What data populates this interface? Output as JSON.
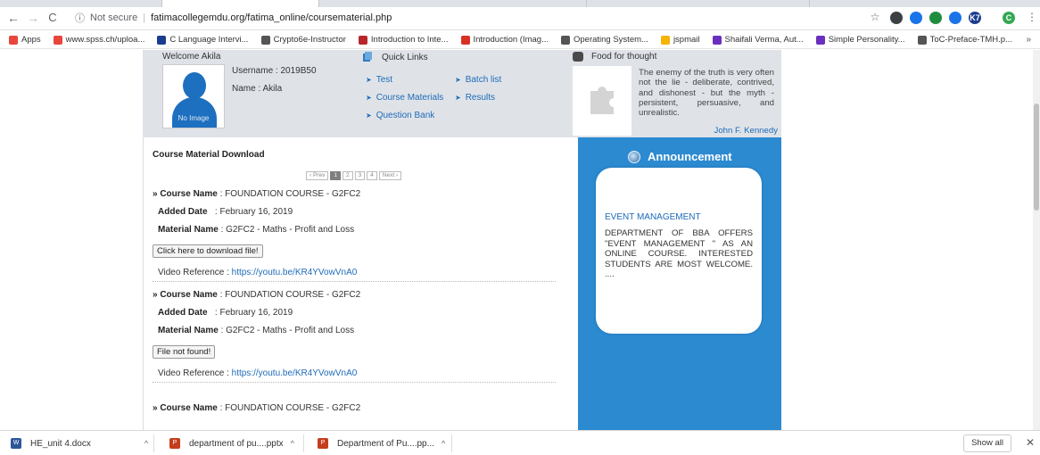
{
  "browser": {
    "address": {
      "security": "Not secure",
      "url": "fatimacollegemdu.org/fatima_online/coursematerial.php"
    },
    "extensions": [
      {
        "label": "",
        "color": "#3c4043"
      },
      {
        "label": "",
        "color": "#1a73e8"
      },
      {
        "label": "",
        "color": "#1e8e3e"
      },
      {
        "label": "",
        "color": "#1a73e8"
      },
      {
        "label": "K7",
        "color": "#1a3d8f"
      },
      {
        "label": "C",
        "color": "#34a853"
      }
    ],
    "bookmarks": [
      {
        "label": "Apps",
        "color": "#e8453c"
      },
      {
        "label": "www.spss.ch/uploa...",
        "color": "#e8453c"
      },
      {
        "label": "C Language Intervi...",
        "color": "#1a3d8f"
      },
      {
        "label": "Crypto6e-Instructor",
        "color": "#555555"
      },
      {
        "label": "Introduction to Inte...",
        "color": "#b8262b"
      },
      {
        "label": "Introduction (Imag...",
        "color": "#d93025"
      },
      {
        "label": "Operating System...",
        "color": "#555555"
      },
      {
        "label": "jspmail",
        "color": "#f4b400"
      },
      {
        "label": "Shaifali Verma, Aut...",
        "color": "#6b2fbf"
      },
      {
        "label": "Simple Personality...",
        "color": "#6b2fbf"
      },
      {
        "label": "ToC-Preface-TMH.p...",
        "color": "#555555"
      }
    ],
    "more_bookmarks": "»"
  },
  "profile": {
    "welcome": "Welcome Akila",
    "username": "Username : 2019B50",
    "name": "Name : Akila",
    "no_image": "No Image"
  },
  "quick_links": {
    "title": "Quick Links",
    "items": [
      "Test",
      "Batch list",
      "Course Materials",
      "Results",
      "Question Bank"
    ]
  },
  "food_for_thought": {
    "title": "Food for thought",
    "quote": "The enemy of the truth is very often not the lie - deliberate, contrived, and dishonest - but the myth - persistent, persuasive, and unrealistic.",
    "author": "John F. Kennedy"
  },
  "course_material": {
    "title": "Course Material Download",
    "pager": {
      "prev": "‹ Prev",
      "pages": [
        "1",
        "2",
        "3",
        "4"
      ],
      "next": "Next ›"
    },
    "entries": [
      {
        "course_label": "» Course Name",
        "course": ": FOUNDATION COURSE - G2FC2",
        "date_label": "Added Date",
        "date": ": February 16, 2019",
        "material_label": "Material Name",
        "material": ": G2FC2 - Maths - Profit and Loss",
        "button": "Click here to download file!",
        "video_label": "Video Reference : ",
        "video_url": "https://youtu.be/KR4YVowVnA0"
      },
      {
        "course_label": "» Course Name",
        "course": ": FOUNDATION COURSE - G2FC2",
        "date_label": "Added Date",
        "date": ": February 16, 2019",
        "material_label": "Material Name",
        "material": ": G2FC2 - Maths - Profit and Loss",
        "button": "File not found!",
        "video_label": "Video Reference : ",
        "video_url": "https://youtu.be/KR4YVowVnA0"
      },
      {
        "course_label": "» Course Name",
        "course": ": FOUNDATION COURSE - G2FC2"
      }
    ]
  },
  "announcement": {
    "title": "Announcement",
    "heading": "EVENT MANAGEMENT",
    "body": "DEPARTMENT OF BBA OFFERS \"EVENT MANAGEMENT \" AS AN ONLINE COURSE. INTERESTED STUDENTS ARE MOST WELCOME. ...."
  },
  "downloads": {
    "items": [
      "HE_unit 4.docx",
      "department of pu....pptx",
      "Department of Pu....pp..."
    ],
    "show_all": "Show all",
    "close": "✕"
  }
}
